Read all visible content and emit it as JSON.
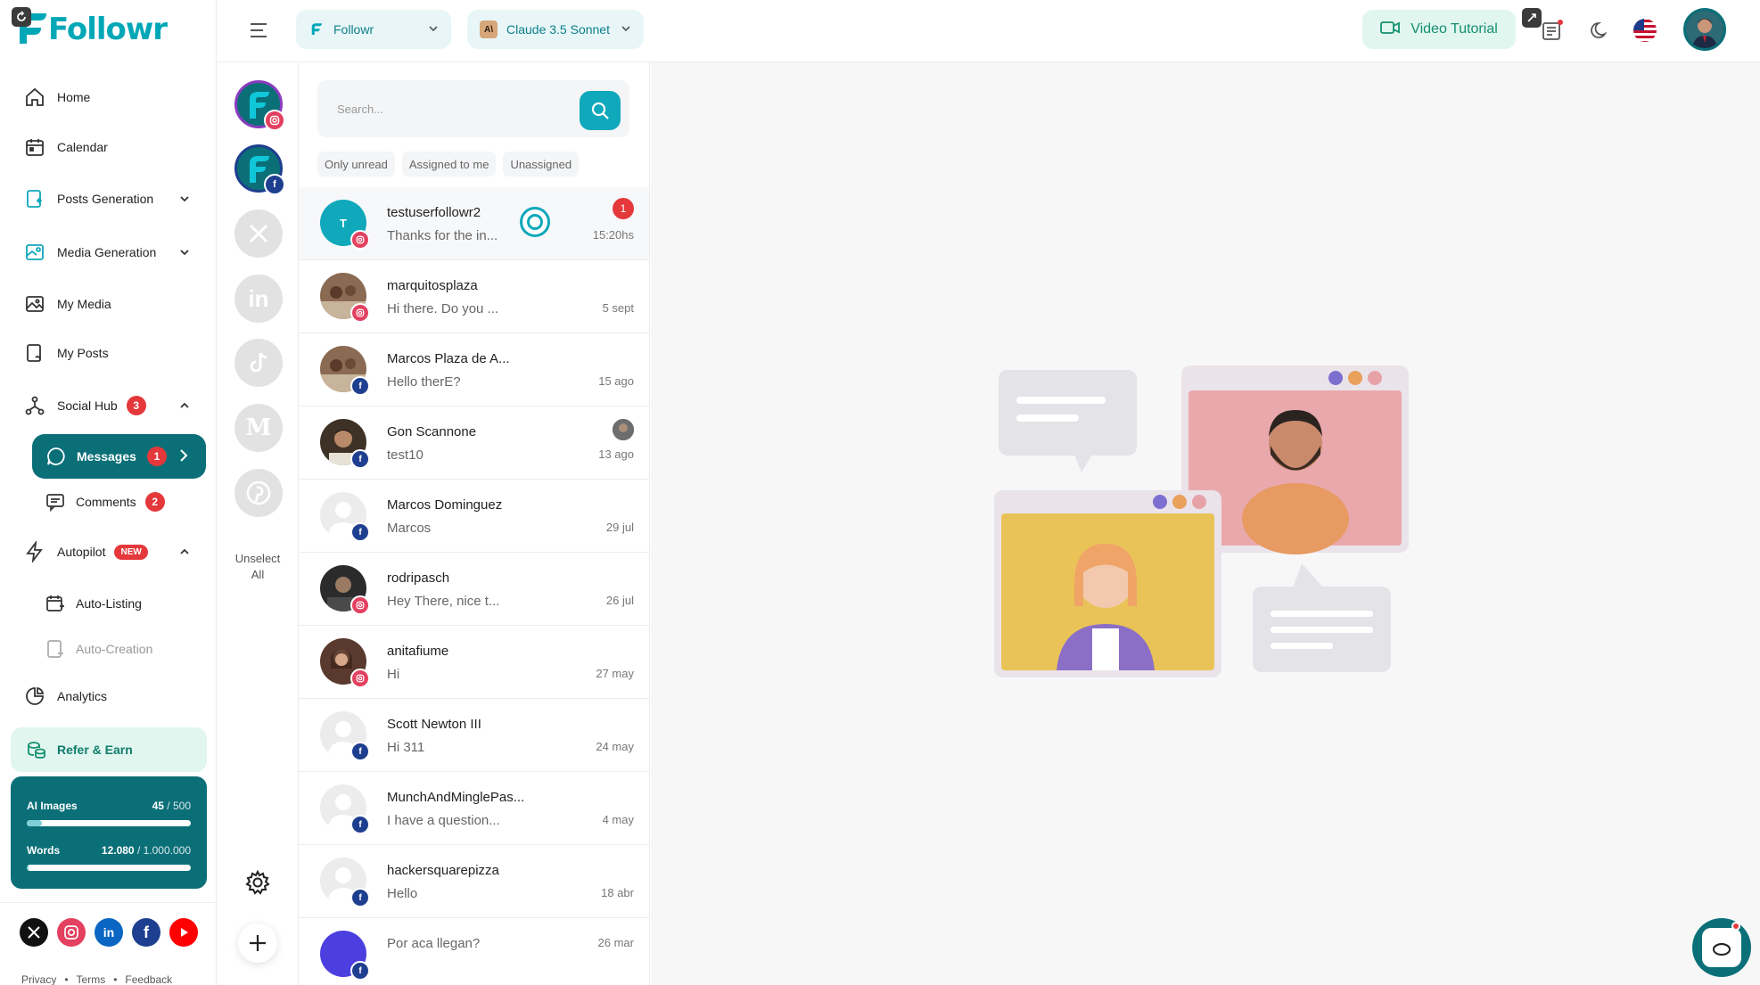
{
  "app": {
    "name": "Followr"
  },
  "sidebar": {
    "items": [
      {
        "label": "Home"
      },
      {
        "label": "Calendar"
      },
      {
        "label": "Posts Generation"
      },
      {
        "label": "Media Generation"
      },
      {
        "label": "My Media"
      },
      {
        "label": "My Posts"
      },
      {
        "label": "Social Hub",
        "badge": "3"
      },
      {
        "label": "Messages",
        "badge": "1"
      },
      {
        "label": "Comments",
        "badge": "2"
      },
      {
        "label": "Autopilot",
        "badge": "NEW"
      },
      {
        "label": "Auto-Listing"
      },
      {
        "label": "Auto-Creation"
      },
      {
        "label": "Analytics"
      },
      {
        "label": "Refer & Earn"
      }
    ],
    "usage": {
      "images_label": "AI Images",
      "images_used": "45",
      "images_total": "/ 500",
      "images_fraction": 0.09,
      "words_label": "Words",
      "words_used": "12.080",
      "words_total": "/ 1.000.000",
      "words_fraction": 0.012
    },
    "footer": [
      "Privacy",
      "Terms",
      "Feedback"
    ]
  },
  "topbar": {
    "workspace": "Followr",
    "model": "Claude 3.5 Sonnet",
    "model_icon_text": "A\\",
    "video_tutorial": "Video Tutorial"
  },
  "accounts": {
    "unselect_line1": "Unselect",
    "unselect_line2": "All"
  },
  "search": {
    "placeholder": "Search..."
  },
  "filters": [
    "Only unread",
    "Assigned to me",
    "Unassigned"
  ],
  "conversations": [
    {
      "name": "testuserfollowr2",
      "message": "Thanks for the in...",
      "time": "15:20hs",
      "unread": "1",
      "network": "instagram",
      "initial": "T"
    },
    {
      "name": "marquitosplaza",
      "message": "Hi there. Do you ...",
      "time": "5 sept",
      "network": "instagram"
    },
    {
      "name": "Marcos Plaza de A...",
      "message": "Hello therE?",
      "time": "15 ago",
      "network": "facebook"
    },
    {
      "name": "Gon Scannone",
      "message": "test10",
      "time": "13 ago",
      "network": "facebook"
    },
    {
      "name": "Marcos Dominguez",
      "message": "Marcos",
      "time": "29 jul",
      "network": "facebook"
    },
    {
      "name": "rodripasch",
      "message": "Hey There, nice t...",
      "time": "26 jul",
      "network": "instagram"
    },
    {
      "name": "anitafiume",
      "message": "Hi",
      "time": "27 may",
      "network": "instagram"
    },
    {
      "name": "Scott Newton III",
      "message": "Hi 311",
      "time": "24 may",
      "network": "facebook"
    },
    {
      "name": "MunchAndMinglePas...",
      "message": "I have a question...",
      "time": "4 may",
      "network": "facebook"
    },
    {
      "name": "hackersquarepizza",
      "message": "Hello",
      "time": "18 abr",
      "network": "facebook"
    },
    {
      "name": "",
      "message": "Por aca llegan?",
      "time": "26 mar",
      "network": "facebook"
    }
  ],
  "colors": {
    "brand": "#00a7b7",
    "accent_dark": "#0b6f78",
    "badge_red": "#e4383b",
    "success_green": "#14906f"
  }
}
